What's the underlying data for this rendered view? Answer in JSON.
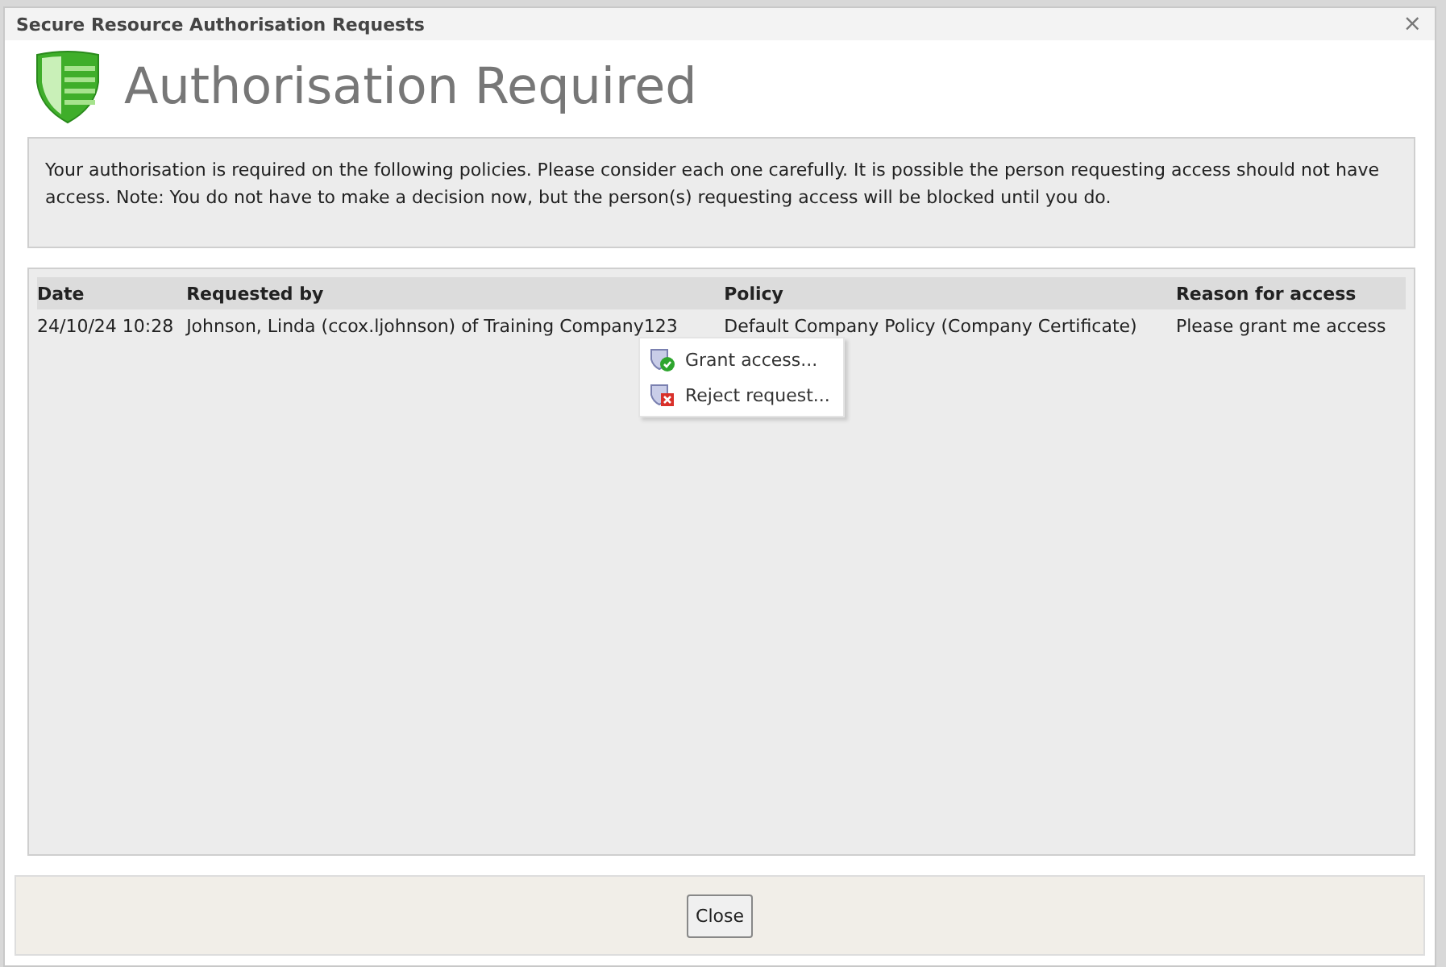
{
  "window": {
    "title": "Secure Resource Authorisation Requests",
    "close": "×"
  },
  "header": {
    "title": "Authorisation Required"
  },
  "notice": "Your authorisation is required on the following policies. Please consider each one carefully. It is possible the person requesting access should not have access. Note: You do not have to make a decision now, but the person(s) requesting access will be blocked until you do.",
  "table": {
    "columns": [
      "Date",
      "Requested by",
      "Policy",
      "Reason for access"
    ],
    "rows": [
      {
        "cells": [
          "24/10/24 10:28",
          "Johnson, Linda (ccox.ljohnson) of Training Company123",
          "Default Company Policy (Company Certificate)",
          "Please grant me access"
        ]
      }
    ]
  },
  "context_menu": {
    "items": [
      {
        "label": "Grant access...",
        "kind": "grant"
      },
      {
        "label": "Reject request...",
        "kind": "reject"
      }
    ]
  },
  "buttons": [
    "Close"
  ]
}
